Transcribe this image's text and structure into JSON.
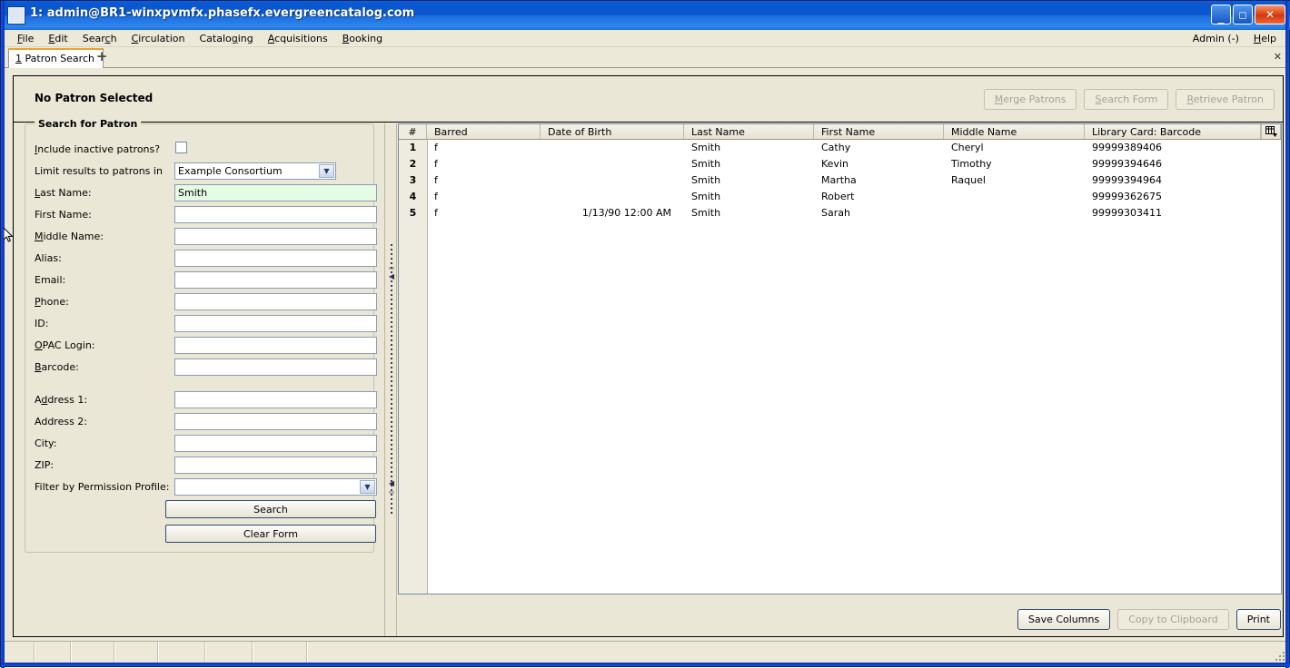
{
  "window": {
    "title": "1: admin@BR1-winxpvmfx.phasefx.evergreencatalog.com",
    "minimize_label": "_",
    "maximize_label": "□",
    "close_label": "✕"
  },
  "menubar": {
    "items": [
      {
        "label": "File",
        "accel": "F"
      },
      {
        "label": "Edit",
        "accel": "E"
      },
      {
        "label": "Search",
        "accel": "c"
      },
      {
        "label": "Circulation",
        "accel": "C"
      },
      {
        "label": "Cataloging",
        "accel": "g"
      },
      {
        "label": "Acquisitions",
        "accel": "A"
      },
      {
        "label": "Booking",
        "accel": "B"
      }
    ],
    "right_items": [
      {
        "label": "Admin (-)"
      },
      {
        "label": "Help"
      }
    ]
  },
  "tabs": {
    "items": [
      {
        "number": "1",
        "label": "Patron Search"
      }
    ],
    "new_tab_label": "+",
    "close_label": "✕"
  },
  "patron_header": {
    "title": "No Patron Selected",
    "buttons": [
      {
        "label": "Merge Patrons",
        "disabled": true
      },
      {
        "label": "Search Form",
        "disabled": true
      },
      {
        "label": "Retrieve Patron",
        "disabled": true
      }
    ]
  },
  "search_form": {
    "group_title": "Search for Patron",
    "fields": [
      {
        "label": "Include inactive patrons?",
        "type": "checkbox",
        "value": "",
        "checked": false
      },
      {
        "label": "Limit results to patrons in",
        "type": "select",
        "value": "Example Consortium"
      },
      {
        "label": "Last Name:",
        "type": "text",
        "value": "Smith",
        "highlight": true
      },
      {
        "label": "First Name:",
        "type": "text",
        "value": ""
      },
      {
        "label": "Middle Name:",
        "type": "text",
        "value": ""
      },
      {
        "label": "Alias:",
        "type": "text",
        "value": ""
      },
      {
        "label": "Email:",
        "type": "text",
        "value": ""
      },
      {
        "label": "Phone:",
        "type": "text",
        "value": ""
      },
      {
        "label": "ID:",
        "type": "text",
        "value": ""
      },
      {
        "label": "OPAC Login:",
        "type": "text",
        "value": ""
      },
      {
        "label": "Barcode:",
        "type": "text",
        "value": ""
      },
      {
        "label": "Address 1:",
        "type": "text",
        "value": ""
      },
      {
        "label": "Address 2:",
        "type": "text",
        "value": ""
      },
      {
        "label": "City:",
        "type": "text",
        "value": ""
      },
      {
        "label": "ZIP:",
        "type": "text",
        "value": ""
      },
      {
        "label": "Filter by Permission Profile:",
        "type": "select",
        "value": ""
      }
    ],
    "search_button": "Search",
    "clear_button": "Clear Form"
  },
  "results": {
    "columns": [
      "#",
      "Barred",
      "Date of Birth",
      "Last Name",
      "First Name",
      "Middle Name",
      "Library Card: Barcode"
    ],
    "column_picker_icon": "columns-icon",
    "rows": [
      {
        "num": "1",
        "barred": "f",
        "dob": "",
        "last": "Smith",
        "first": "Cathy",
        "middle": "Cheryl",
        "barcode": "99999389406"
      },
      {
        "num": "2",
        "barred": "f",
        "dob": "",
        "last": "Smith",
        "first": "Kevin",
        "middle": "Timothy",
        "barcode": "99999394646"
      },
      {
        "num": "3",
        "barred": "f",
        "dob": "",
        "last": "Smith",
        "first": "Martha",
        "middle": "Raquel",
        "barcode": "99999394964"
      },
      {
        "num": "4",
        "barred": "f",
        "dob": "",
        "last": "Smith",
        "first": "Robert",
        "middle": "",
        "barcode": "99999362675"
      },
      {
        "num": "5",
        "barred": "f",
        "dob": "1/13/90 12:00 AM",
        "last": "Smith",
        "first": "Sarah",
        "middle": "",
        "barcode": "99999303411"
      }
    ],
    "buttons": [
      {
        "label": "Save Columns",
        "disabled": false,
        "default": true
      },
      {
        "label": "Copy to Clipboard",
        "disabled": true,
        "default": false
      },
      {
        "label": "Print",
        "disabled": false,
        "default": true
      }
    ]
  },
  "statusbar": {
    "cells": [
      "",
      "",
      "",
      "",
      "",
      "",
      "",
      ""
    ]
  },
  "colors": {
    "window_chrome": "#ece9d8",
    "panel": "#eae7d6",
    "titlebar_blue": "#0a57d0",
    "tab_accent": "#f0a030",
    "highlight_field": "#e4fbe4",
    "table_bg": "#ffffff",
    "numcol_bg": "#eeece0"
  }
}
